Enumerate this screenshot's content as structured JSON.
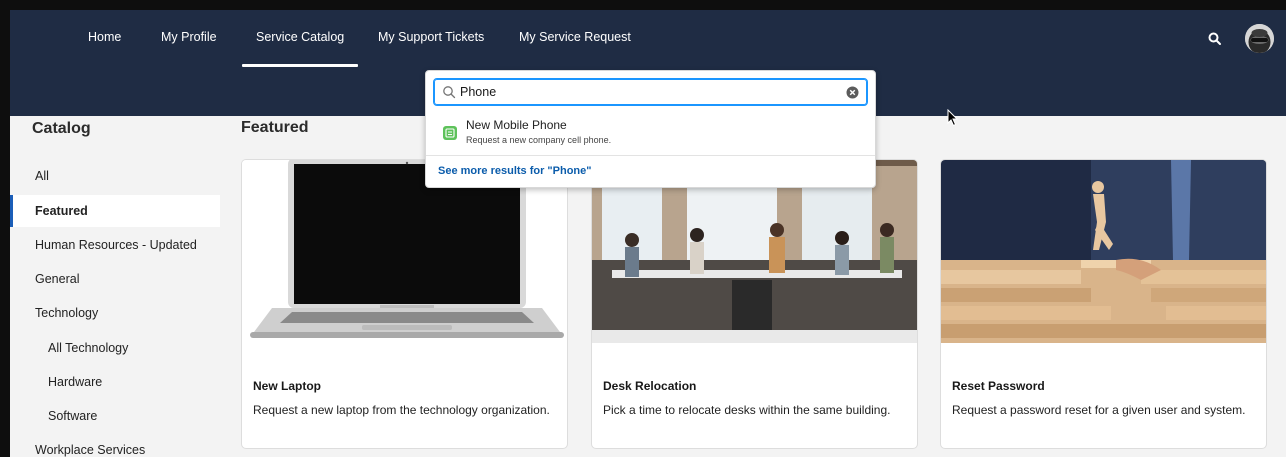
{
  "nav": {
    "items": [
      {
        "label": "Home"
      },
      {
        "label": "My Profile"
      },
      {
        "label": "Service Catalog"
      },
      {
        "label": "My Support Tickets"
      },
      {
        "label": "My Service Request"
      }
    ],
    "active": "Service Catalog",
    "search_icon": "search-icon",
    "avatar_icon": "avatar"
  },
  "sidebar": {
    "title": "Catalog",
    "items": [
      {
        "label": "All"
      },
      {
        "label": "Featured"
      },
      {
        "label": "Human Resources - Updated"
      },
      {
        "label": "General"
      },
      {
        "label": "Technology"
      },
      {
        "label": "All Technology"
      },
      {
        "label": "Hardware"
      },
      {
        "label": "Software"
      },
      {
        "label": "Workplace Services"
      }
    ],
    "active": "Featured"
  },
  "main": {
    "title": "Featured",
    "cards": [
      {
        "title": "New Laptop",
        "description": "Request a new laptop from the technology organization."
      },
      {
        "title": "Desk Relocation",
        "description": "Pick a time to relocate desks within the same building."
      },
      {
        "title": "Reset Password",
        "description": "Request a password reset for a given user and system."
      }
    ]
  },
  "search": {
    "value": "Phone",
    "results": [
      {
        "title": "New Mobile Phone",
        "subtitle": "Request a new company cell phone."
      }
    ],
    "see_more": "See more results for \"Phone\""
  },
  "colors": {
    "topbar": "#1f2c44",
    "accent": "#1b5eb8",
    "link": "#0b5cab",
    "focus": "#1b96ff",
    "result_icon": "#5ec25b"
  }
}
